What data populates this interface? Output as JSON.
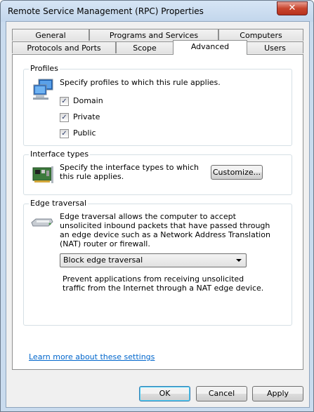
{
  "window": {
    "title": "Remote Service Management (RPC) Properties",
    "close_glyph": "✕"
  },
  "tabs": {
    "row1": [
      {
        "label": "General"
      },
      {
        "label": "Programs and Services"
      },
      {
        "label": "Computers"
      }
    ],
    "row2": [
      {
        "label": "Protocols and Ports"
      },
      {
        "label": "Scope"
      },
      {
        "label": "Advanced",
        "selected": true
      },
      {
        "label": "Users"
      }
    ]
  },
  "profiles": {
    "heading": "Profiles",
    "description": "Specify profiles to which this rule applies.",
    "options": [
      {
        "label": "Domain",
        "checked": true
      },
      {
        "label": "Private",
        "checked": true
      },
      {
        "label": "Public",
        "checked": true
      }
    ],
    "check_glyph": "✓",
    "icon": "firewall-profiles-icon"
  },
  "interface_types": {
    "heading": "Interface types",
    "description": "Specify the interface types to which this rule applies.",
    "customize_label": "Customize...",
    "icon": "network-card-icon"
  },
  "edge_traversal": {
    "heading": "Edge traversal",
    "description": "Edge traversal allows the computer to accept unsolicited inbound packets that have passed through an edge device such as a Network Address Translation (NAT) router or firewall.",
    "selected_option": "Block edge traversal",
    "option_detail": "Prevent applications from receiving unsolicited traffic from the Internet through a NAT edge device.",
    "icon": "edge-device-icon"
  },
  "learn_more_link": "Learn more about these settings",
  "buttons": {
    "ok": "OK",
    "cancel": "Cancel",
    "apply": "Apply"
  },
  "colors": {
    "link": "#0066cc",
    "default_button_border": "#3c7fb1"
  }
}
